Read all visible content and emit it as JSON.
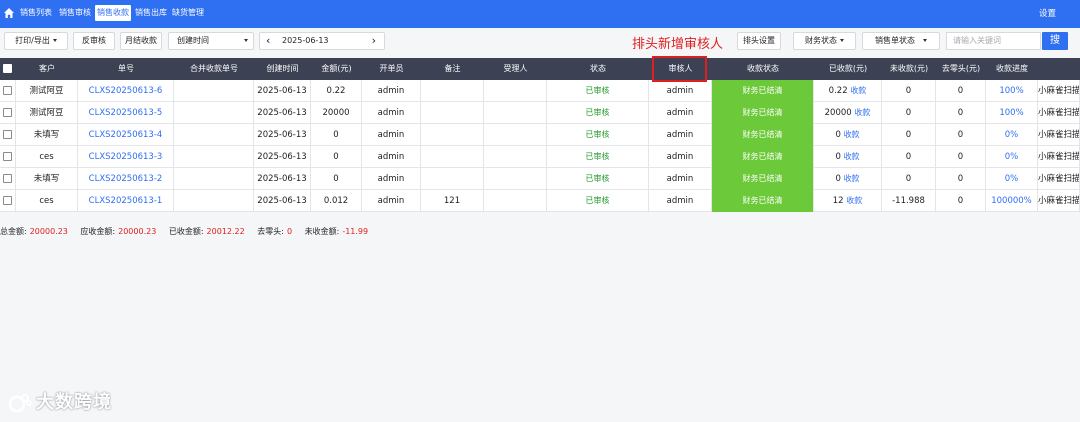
{
  "nav": {
    "tabs": [
      "销售列表",
      "销售审核",
      "销售收款",
      "销售出库",
      "缺货管理"
    ],
    "active_index": 2,
    "settings": "设置"
  },
  "toolbar": {
    "print": "打印/导出",
    "unaudit": "反审核",
    "monthly": "月结收款",
    "date_field": "创建时间",
    "date": "2025-06-13",
    "prev": "‹",
    "next": "›",
    "header_settings": "排头设置",
    "finance_status": "财务状态",
    "order_status": "销售单状态",
    "search_placeholder": "请输入关键词",
    "search": "搜"
  },
  "annotation": "排头新增审核人",
  "columns": [
    "客户",
    "单号",
    "合并收款单号",
    "创建时间",
    "金额(元)",
    "开单员",
    "备注",
    "受理人",
    "状态",
    "审核人",
    "收款状态",
    "已收款(元)",
    "未收款(元)",
    "去零头(元)",
    "收款进度",
    ""
  ],
  "rows": [
    {
      "customer": "测试阿豆",
      "order": "CLXS20250613-6",
      "merge": "",
      "created": "2025-06-13",
      "amount": "0.22",
      "opener": "admin",
      "note": "",
      "handler": "",
      "status": "已审核",
      "auditor": "admin",
      "pay_status": "财务已结清",
      "received": "0.22",
      "recv_link": "收款",
      "unpaid": "0",
      "rounding": "0",
      "progress": "100%",
      "extra": "小麻雀扫描"
    },
    {
      "customer": "测试阿豆",
      "order": "CLXS20250613-5",
      "merge": "",
      "created": "2025-06-13",
      "amount": "20000",
      "opener": "admin",
      "note": "",
      "handler": "",
      "status": "已审核",
      "auditor": "admin",
      "pay_status": "财务已结清",
      "received": "20000",
      "recv_link": "收款",
      "unpaid": "0",
      "rounding": "0",
      "progress": "100%",
      "extra": "小麻雀扫描"
    },
    {
      "customer": "未填写",
      "order": "CLXS20250613-4",
      "merge": "",
      "created": "2025-06-13",
      "amount": "0",
      "opener": "admin",
      "note": "",
      "handler": "",
      "status": "已审核",
      "auditor": "admin",
      "pay_status": "财务已结清",
      "received": "0",
      "recv_link": "收款",
      "unpaid": "0",
      "rounding": "0",
      "progress": "0%",
      "extra": "小麻雀扫描"
    },
    {
      "customer": "ces",
      "order": "CLXS20250613-3",
      "merge": "",
      "created": "2025-06-13",
      "amount": "0",
      "opener": "admin",
      "note": "",
      "handler": "",
      "status": "已审核",
      "auditor": "admin",
      "pay_status": "财务已结清",
      "received": "0",
      "recv_link": "收款",
      "unpaid": "0",
      "rounding": "0",
      "progress": "0%",
      "extra": "小麻雀扫描"
    },
    {
      "customer": "未填写",
      "order": "CLXS20250613-2",
      "merge": "",
      "created": "2025-06-13",
      "amount": "0",
      "opener": "admin",
      "note": "",
      "handler": "",
      "status": "已审核",
      "auditor": "admin",
      "pay_status": "财务已结清",
      "received": "0",
      "recv_link": "收款",
      "unpaid": "0",
      "rounding": "0",
      "progress": "0%",
      "extra": "小麻雀扫描"
    },
    {
      "customer": "ces",
      "order": "CLXS20250613-1",
      "merge": "",
      "created": "2025-06-13",
      "amount": "0.012",
      "opener": "admin",
      "note": "121",
      "handler": "",
      "status": "已审核",
      "auditor": "admin",
      "pay_status": "财务已结清",
      "received": "12",
      "recv_link": "收款",
      "unpaid": "-11.988",
      "rounding": "0",
      "progress": "100000%",
      "extra": "小麻雀扫描"
    }
  ],
  "summary": {
    "total_label": "总金额:",
    "total": "20000.23",
    "receivable_label": "应收金额:",
    "receivable": "20000.23",
    "received_label": "已收金额:",
    "received": "20012.22",
    "rounding_label": "去零头:",
    "rounding": "0",
    "unpaid_label": "未收金额:",
    "unpaid": "-11.99"
  },
  "watermark": "大数跨境",
  "colors": {
    "nav": "#2f6ff2",
    "header": "#3c4254",
    "paid": "#6cc93a",
    "highlight": "#e02020"
  }
}
